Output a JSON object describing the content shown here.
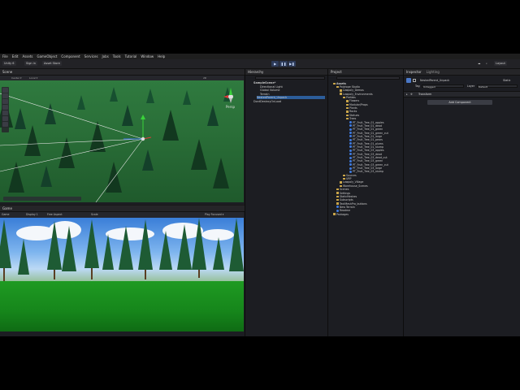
{
  "menu": [
    "File",
    "Edit",
    "Assets",
    "GameObject",
    "Component",
    "Services",
    "Jobs",
    "Tools",
    "Tutorial",
    "Window",
    "Help"
  ],
  "toolbar": {
    "account": "Unity 6",
    "sign_in": "Sign in",
    "asset_store": "Asset Store",
    "layout": "Layout",
    "play": "▶",
    "pause": "❚❚",
    "step": "▶❚",
    "cloud": "☁",
    "search": "⌕"
  },
  "tabs": {
    "scene": "Scene",
    "game": "Game",
    "hierarchy": "Hierarchy",
    "project": "Project",
    "inspector": "Inspector",
    "lighting": "Lighting"
  },
  "scene_toolbar": [
    "Center ▾",
    "Local ▾",
    "2D",
    "Persp"
  ],
  "game_toolbar": {
    "mode": "Game",
    "display": "Display 1",
    "aspect": "Free Aspect",
    "scale": "Scale",
    "playfocus": "Play Focused ▾"
  },
  "hierarchy": {
    "scene": "SampleScene*",
    "items": [
      "Directional Light",
      "Global Volume",
      "Terrain",
      "NestedParent_Unpack",
      "DontDestroyOnLoad"
    ]
  },
  "project": {
    "root": "Assets",
    "items": [
      {
        "label": "Polytope Studio",
        "depth": 1,
        "type": "folder"
      },
      {
        "label": "Lowpoly_Demos",
        "depth": 2,
        "type": "folder"
      },
      {
        "label": "Lowpoly_Environments",
        "depth": 2,
        "type": "folder"
      },
      {
        "label": "Prefabs",
        "depth": 3,
        "type": "folder"
      },
      {
        "label": "Flowers",
        "depth": 4,
        "type": "folder"
      },
      {
        "label": "Modular/Props",
        "depth": 4,
        "type": "folder"
      },
      {
        "label": "Plants",
        "depth": 4,
        "type": "folder"
      },
      {
        "label": "Rocks",
        "depth": 4,
        "type": "folder"
      },
      {
        "label": "Statues",
        "depth": 4,
        "type": "folder"
      },
      {
        "label": "Trees",
        "depth": 4,
        "type": "folder"
      },
      {
        "label": "PT_Fruit_Tree_01_apples",
        "depth": 5,
        "type": "asset"
      },
      {
        "label": "PT_Fruit_Tree_01_dead",
        "depth": 5,
        "type": "asset"
      },
      {
        "label": "PT_Fruit_Tree_01_green",
        "depth": 5,
        "type": "asset"
      },
      {
        "label": "PT_Fruit_Tree_01_green_cut",
        "depth": 5,
        "type": "asset"
      },
      {
        "label": "PT_Fruit_Tree_01_large",
        "depth": 5,
        "type": "asset"
      },
      {
        "label": "PT_Fruit_Tree_01_pears",
        "depth": 5,
        "type": "asset"
      },
      {
        "label": "PT_Fruit_Tree_01_plums",
        "depth": 5,
        "type": "asset"
      },
      {
        "label": "PT_Fruit_Tree_01_stump",
        "depth": 5,
        "type": "asset"
      },
      {
        "label": "PT_Fruit_Tree_03_apples",
        "depth": 5,
        "type": "asset"
      },
      {
        "label": "PT_Fruit_Tree_03_dead",
        "depth": 5,
        "type": "asset"
      },
      {
        "label": "PT_Fruit_Tree_03_dead_cut",
        "depth": 5,
        "type": "asset"
      },
      {
        "label": "PT_Fruit_Tree_03_green",
        "depth": 5,
        "type": "asset"
      },
      {
        "label": "PT_Fruit_Tree_03_green_cut",
        "depth": 5,
        "type": "asset"
      },
      {
        "label": "PT_Fruit_Tree_03_large",
        "depth": 5,
        "type": "asset"
      },
      {
        "label": "PT_Fruit_Tree_03_stump",
        "depth": 5,
        "type": "asset"
      },
      {
        "label": "Sources",
        "depth": 3,
        "type": "folder"
      },
      {
        "label": "URP",
        "depth": 3,
        "type": "folder"
      },
      {
        "label": "Lowpoly_Village",
        "depth": 2,
        "type": "folder"
      },
      {
        "label": "Warehouse_Scenes",
        "depth": 2,
        "type": "folder"
      },
      {
        "label": "Scenes",
        "depth": 1,
        "type": "folder"
      },
      {
        "label": "Settings",
        "depth": 1,
        "type": "folder"
      },
      {
        "label": "StaticMeshes",
        "depth": 1,
        "type": "folder"
      },
      {
        "label": "Subscripts",
        "depth": 1,
        "type": "folder"
      },
      {
        "label": "TextMeshPro_buttons",
        "depth": 1,
        "type": "folder"
      },
      {
        "label": "New Terrain",
        "depth": 1,
        "type": "asset"
      },
      {
        "label": "Readme",
        "depth": 1,
        "type": "asset"
      },
      {
        "label": "Packages",
        "depth": 0,
        "type": "folder"
      }
    ]
  },
  "inspector": {
    "object_name": "NestedParent_Unpack",
    "static_label": "Static",
    "tag_label": "Tag",
    "tag_value": "Untagged",
    "layer_label": "Layer",
    "layer_value": "Default",
    "transform": "Transform",
    "add_component": "Add Component"
  },
  "colors": {
    "accent": "#2c5d9a",
    "panel": "#1c1d22",
    "folder": "#c9a54a",
    "prefab": "#3f7be0"
  }
}
